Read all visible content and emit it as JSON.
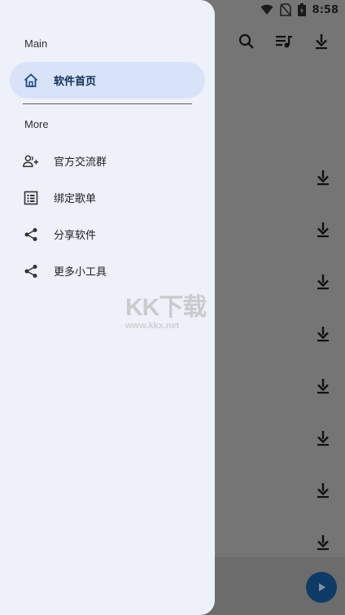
{
  "status_bar": {
    "time": "8:58"
  },
  "drawer": {
    "section_main": "Main",
    "section_more": "More",
    "main_items": [
      {
        "label": "软件首页",
        "icon": "home-icon",
        "active": true
      }
    ],
    "more_items": [
      {
        "label": "官方交流群",
        "icon": "group-add-icon"
      },
      {
        "label": "绑定歌单",
        "icon": "list-icon"
      },
      {
        "label": "分享软件",
        "icon": "share-icon"
      },
      {
        "label": "更多小工具",
        "icon": "share-icon"
      }
    ]
  },
  "watermark": {
    "logo": "KK下载",
    "url": "www.kkx.net"
  },
  "colors": {
    "drawer_bg": "#eef1fa",
    "active_pill": "#d8e2f8",
    "fab": "#0e3a66",
    "scrim": "#757575"
  }
}
